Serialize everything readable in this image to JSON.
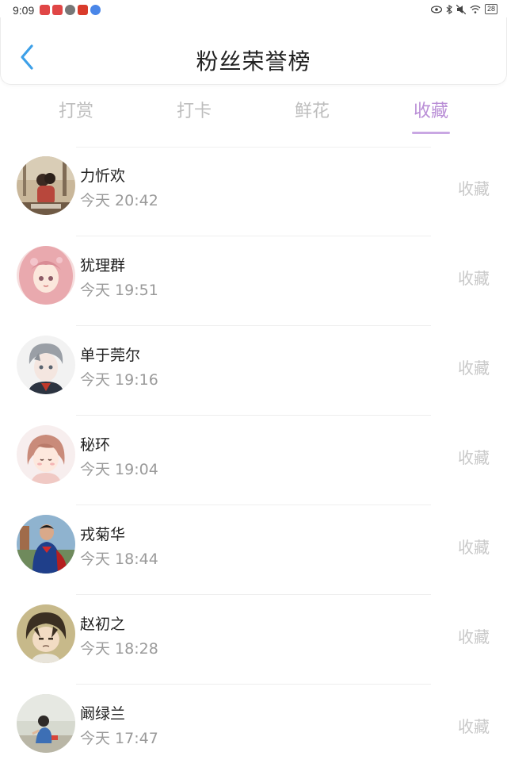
{
  "status_bar": {
    "time": "9:09",
    "battery": "28"
  },
  "header": {
    "title": "粉丝荣誉榜"
  },
  "tabs": [
    {
      "label": "打赏",
      "active": false
    },
    {
      "label": "打卡",
      "active": false
    },
    {
      "label": "鲜花",
      "active": false
    },
    {
      "label": "收藏",
      "active": true
    }
  ],
  "colors": {
    "accent": "#b98ed6",
    "back_arrow": "#3da0e8",
    "muted": "#c8c8c8"
  },
  "list": [
    {
      "name": "力忻欢",
      "time": "今天 20:42",
      "action": "收藏",
      "avatar_icon": "couple-photo-avatar"
    },
    {
      "name": "犹理群",
      "time": "今天 19:51",
      "action": "收藏",
      "avatar_icon": "pink-hair-girl-avatar"
    },
    {
      "name": "单于莞尔",
      "time": "今天 19:16",
      "action": "收藏",
      "avatar_icon": "grey-hair-boy-avatar"
    },
    {
      "name": "秘环",
      "time": "今天 19:04",
      "action": "收藏",
      "avatar_icon": "anime-girl-avatar"
    },
    {
      "name": "戎菊华",
      "time": "今天 18:44",
      "action": "收藏",
      "avatar_icon": "superhero-avatar"
    },
    {
      "name": "赵初之",
      "time": "今天 18:28",
      "action": "收藏",
      "avatar_icon": "cartoon-boy-avatar"
    },
    {
      "name": "阚绿兰",
      "time": "今天 17:47",
      "action": "收藏",
      "avatar_icon": "child-photo-avatar"
    }
  ]
}
